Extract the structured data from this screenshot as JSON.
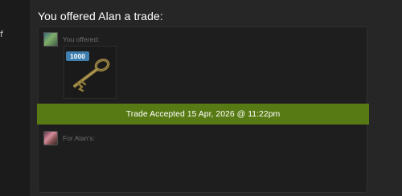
{
  "trade": {
    "title": "You offered Alan a trade:",
    "you_offered_label": "You offered:",
    "for_label": "For Alan's:",
    "status": "Trade Accepted 15 Apr, 2026 @ 11:22pm",
    "item": {
      "quantity": "1000",
      "icon": "key-icon"
    }
  },
  "left_edge_glyph": "f",
  "colors": {
    "status_bar": "#587a14",
    "quantity_badge": "#3f7fb0"
  }
}
